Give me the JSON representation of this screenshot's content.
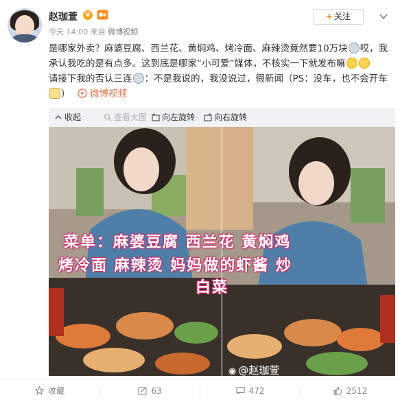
{
  "header": {
    "username": "赵珈萱",
    "verified_badge": "V",
    "time": "今天 14:00",
    "source_prefix": "来自",
    "source": "微博视频",
    "follow_label": "关注",
    "follow_plus": "+"
  },
  "post": {
    "segment1": "是哪家外卖？麻婆豆腐、西兰花、黄焖鸡、烤冷面、麻辣烫竟然要10万块",
    "segment2": "哎，我承认我吃的是有点多。这到底是哪家“小可爱”媒体，不核实一下就发布嘛",
    "segment3": "请接下我的否认三连",
    "segment4": "：不是我说的，我没说过，假新闻（PS：没车，也不会开车",
    "segment5": "）",
    "video_link": "微博视频"
  },
  "media_toolbar": {
    "collapse": "收起",
    "view_large": "查看大图",
    "rotate_left": "向左旋转",
    "rotate_right": "向右旋转"
  },
  "photo": {
    "overlay_line1": "菜单：麻婆豆腐 西兰花 黄焖鸡",
    "overlay_line2": "烤冷面 麻辣烫 妈妈做的虾酱 炒",
    "overlay_line3": "白菜",
    "watermark": "@赵珈萱"
  },
  "footer": {
    "favorite_label": "收藏",
    "repost_count": "63",
    "comment_count": "472",
    "like_count": "2512"
  },
  "icons": [
    "v-verified-icon",
    "level-badge-icon",
    "more-chevron-icon",
    "video-play-icon",
    "collapse-icon",
    "zoom-icon",
    "rotate-left-icon",
    "rotate-right-icon",
    "star-icon",
    "repost-icon",
    "comment-icon",
    "like-icon"
  ],
  "colors": {
    "accent_orange": "#ff8200",
    "link_orange": "#eb7350",
    "text": "#333333",
    "muted": "#808080",
    "overlay_text_glow": "#d02a6a"
  }
}
